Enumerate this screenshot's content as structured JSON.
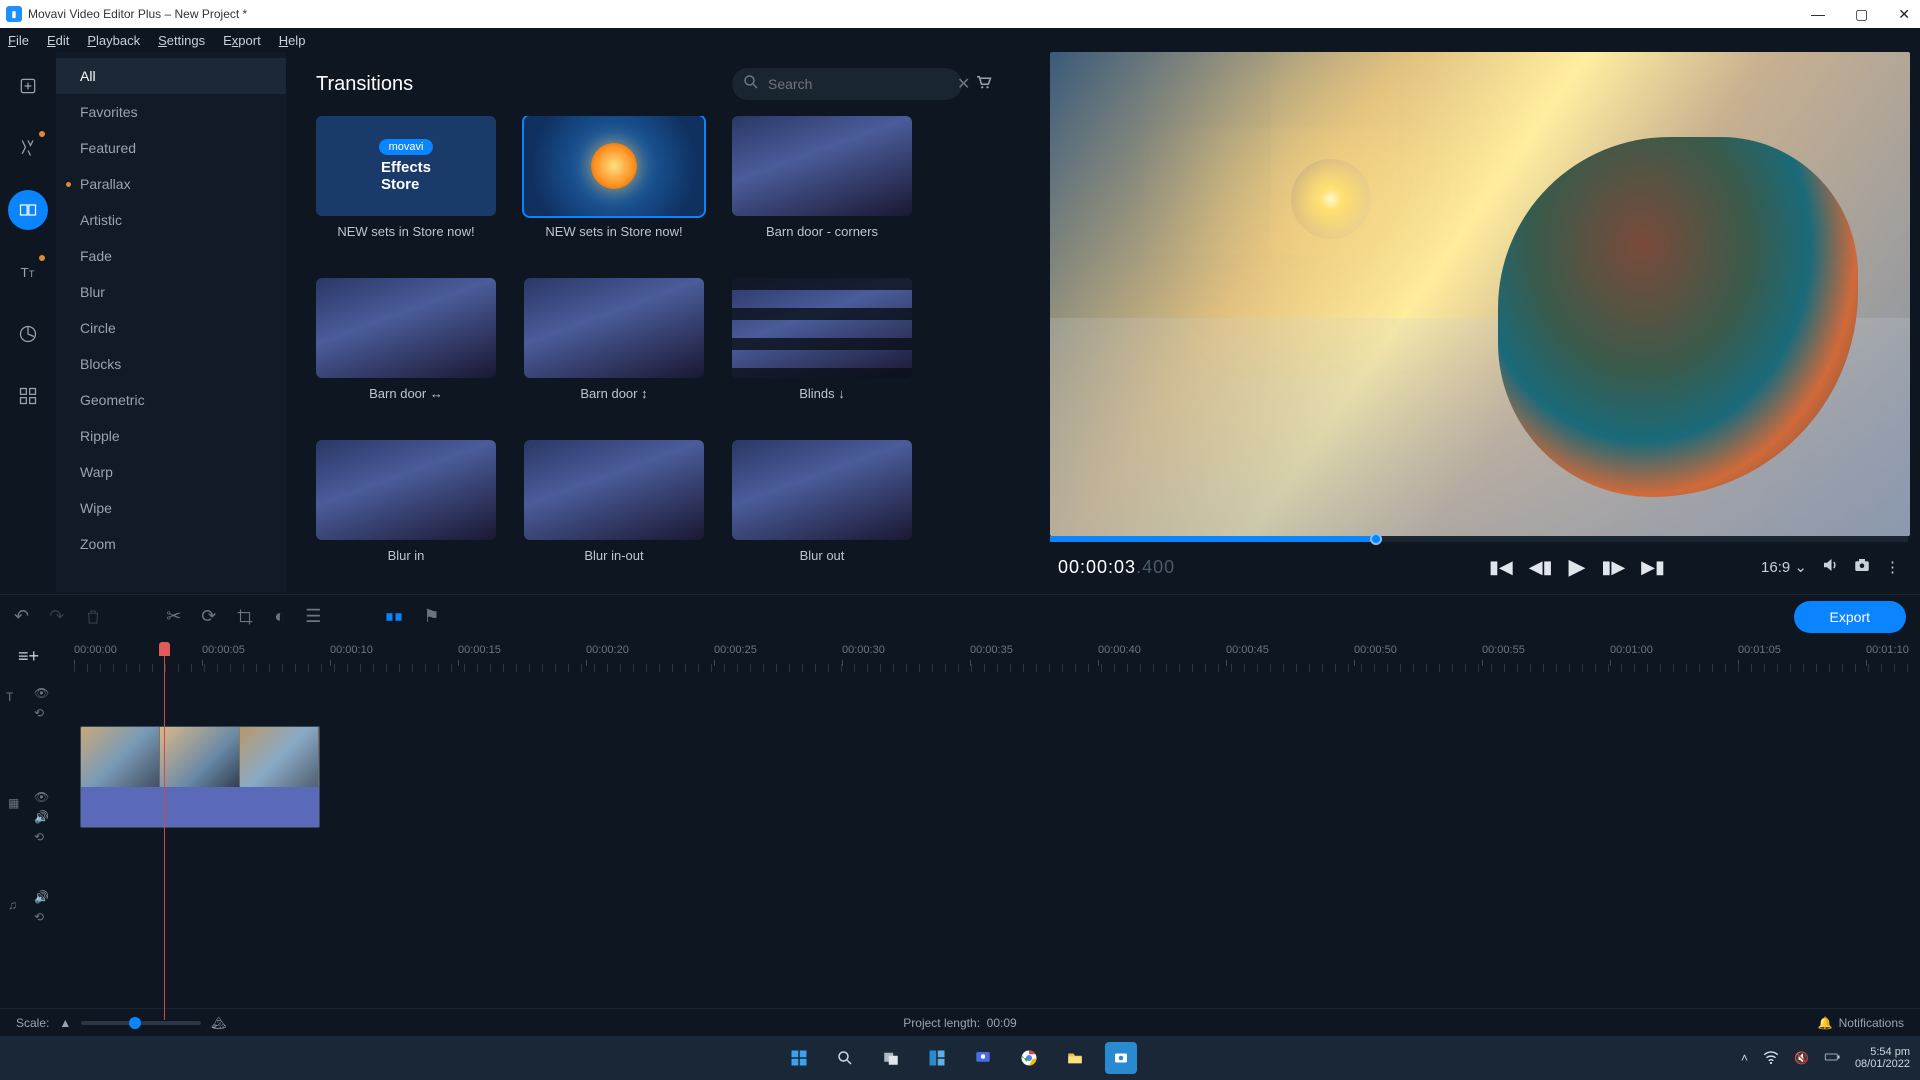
{
  "window": {
    "title": "Movavi Video Editor Plus – New Project *"
  },
  "menu": {
    "file": "File",
    "edit": "Edit",
    "playback": "Playback",
    "settings": "Settings",
    "export": "Export",
    "help": "Help"
  },
  "categories": [
    {
      "k": "all",
      "label": "All",
      "selected": true
    },
    {
      "k": "favorites",
      "label": "Favorites"
    },
    {
      "k": "featured",
      "label": "Featured"
    },
    {
      "k": "parallax",
      "label": "Parallax",
      "dot": true
    },
    {
      "k": "artistic",
      "label": "Artistic"
    },
    {
      "k": "fade",
      "label": "Fade"
    },
    {
      "k": "blur",
      "label": "Blur"
    },
    {
      "k": "circle",
      "label": "Circle"
    },
    {
      "k": "blocks",
      "label": "Blocks"
    },
    {
      "k": "geometric",
      "label": "Geometric"
    },
    {
      "k": "ripple",
      "label": "Ripple"
    },
    {
      "k": "warp",
      "label": "Warp"
    },
    {
      "k": "wipe",
      "label": "Wipe"
    },
    {
      "k": "zoom",
      "label": "Zoom"
    }
  ],
  "panel": {
    "title": "Transitions",
    "search_placeholder": "Search",
    "tiles": [
      {
        "label": "NEW sets in Store now!",
        "kind": "store1",
        "tag": "movavi",
        "bt": "Effects\nStore"
      },
      {
        "label": "NEW sets in Store now!",
        "kind": "store2",
        "selected": true
      },
      {
        "label": "Barn door - corners"
      },
      {
        "label": "Barn door ↔"
      },
      {
        "label": "Barn door ↕"
      },
      {
        "label": "Blinds ↓",
        "stripes": true
      },
      {
        "label": "Blur in"
      },
      {
        "label": "Blur in-out"
      },
      {
        "label": "Blur out"
      }
    ]
  },
  "preview": {
    "timecode": "00:00:03",
    "timecode_ms": ".400",
    "aspect": "16:9",
    "help": "?"
  },
  "toolbar": {
    "export": "Export"
  },
  "ruler": [
    "00:00:00",
    "00:00:05",
    "00:00:10",
    "00:00:15",
    "00:00:20",
    "00:00:25",
    "00:00:30",
    "00:00:35",
    "00:00:40",
    "00:00:45",
    "00:00:50",
    "00:00:55",
    "00:01:00",
    "00:01:05",
    "00:01:10"
  ],
  "status": {
    "scale_label": "Scale:",
    "project_length_label": "Project length:",
    "project_length_value": "00:09",
    "notifications": "Notifications"
  },
  "taskbar": {
    "time": "5:54 pm",
    "date": "08/01/2022"
  }
}
